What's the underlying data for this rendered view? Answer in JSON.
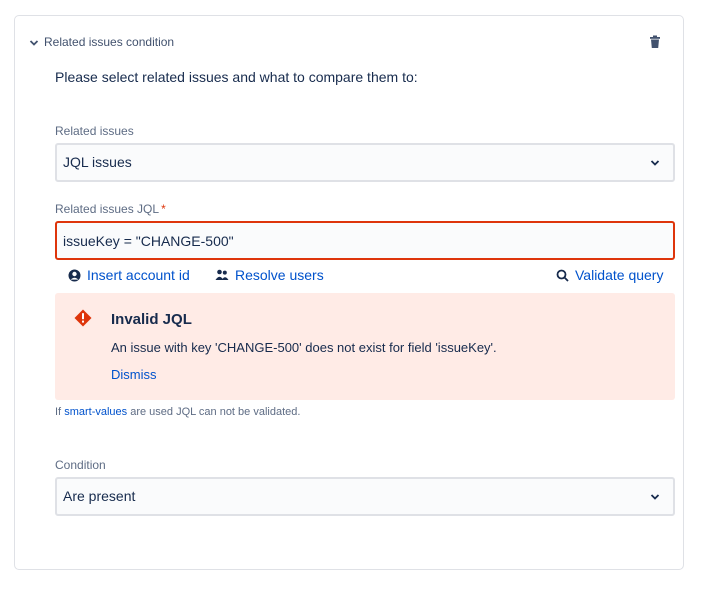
{
  "header": {
    "title": "Related issues condition",
    "chevron_icon": "chevron-down-icon",
    "delete_icon": "trash-icon"
  },
  "instructions": "Please select related issues and what to compare them to:",
  "related_issues": {
    "label": "Related issues",
    "value": "JQL issues"
  },
  "jql": {
    "label": "Related issues JQL",
    "required_marker": "*",
    "value": "issueKey = \"CHANGE-500\""
  },
  "actions": {
    "insert_account_id": "Insert account id",
    "resolve_users": "Resolve users",
    "validate_query": "Validate query"
  },
  "error": {
    "title": "Invalid JQL",
    "message": "An issue with key 'CHANGE-500' does not exist for field 'issueKey'.",
    "dismiss": "Dismiss"
  },
  "hint": {
    "prefix": "If",
    "link": "smart-values",
    "suffix": "are used JQL can not be validated."
  },
  "condition": {
    "label": "Condition",
    "value": "Are present"
  },
  "colors": {
    "link": "#0052cc",
    "error_border": "#de350b",
    "error_bg": "#ffebe6"
  }
}
